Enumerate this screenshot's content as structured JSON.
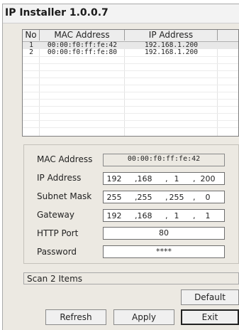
{
  "window": {
    "title": "IP Installer 1.0.0.7"
  },
  "device_list": {
    "columns": [
      "No",
      "MAC Address",
      "IP Address"
    ],
    "rows": [
      {
        "no": "1",
        "mac": "00:00:f0:ff:fe:42",
        "ip": "192.168.1.200",
        "selected": true
      },
      {
        "no": "2",
        "mac": "00:00:f0:ff:fe:80",
        "ip": "192.168.1.200",
        "selected": false
      }
    ]
  },
  "form": {
    "mac_address_label": "MAC Address",
    "mac_address_value": "00:00:f0:ff:fe:42",
    "ip_address_label": "IP Address",
    "ip_address": [
      "192",
      "168",
      "1",
      "200"
    ],
    "subnet_mask_label": "Subnet Mask",
    "subnet_mask": [
      "255",
      "255",
      "255",
      "0"
    ],
    "gateway_label": "Gateway",
    "gateway": [
      "192",
      "168",
      "1",
      "1"
    ],
    "http_port_label": "HTTP Port",
    "http_port_value": "80",
    "password_label": "Password",
    "password_value": "****"
  },
  "status": {
    "text": "Scan 2 Items"
  },
  "buttons": {
    "default_label": "Default",
    "refresh_label": "Refresh",
    "apply_label": "Apply",
    "exit_label": "Exit"
  }
}
